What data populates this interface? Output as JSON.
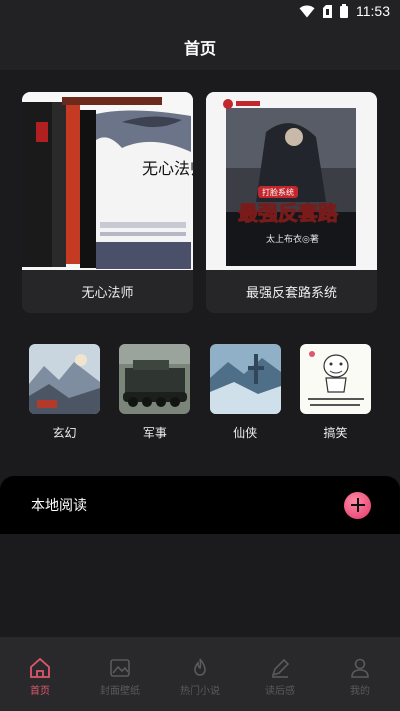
{
  "status_bar": {
    "time": "11:53"
  },
  "header": {
    "title": "首页"
  },
  "featured_books": [
    {
      "title": "无心法师",
      "cover_title": "无心法师"
    },
    {
      "title": "最强反套路系统",
      "cover_title": "最强反套路",
      "cover_tag": "打脸系统",
      "author": "太上布衣◎著"
    }
  ],
  "categories": [
    {
      "label": "玄幻"
    },
    {
      "label": "军事"
    },
    {
      "label": "仙侠"
    },
    {
      "label": "搞笑"
    }
  ],
  "local_reading": {
    "title": "本地阅读"
  },
  "tabbar": {
    "items": [
      {
        "label": "首页",
        "icon": "home-icon"
      },
      {
        "label": "封面壁纸",
        "icon": "image-icon"
      },
      {
        "label": "热门小说",
        "icon": "fire-icon"
      },
      {
        "label": "读后感",
        "icon": "pen-icon"
      },
      {
        "label": "我的",
        "icon": "user-icon"
      }
    ]
  },
  "colors": {
    "accent": "#e0566d",
    "background": "#1b1b1d",
    "card": "#262628"
  }
}
